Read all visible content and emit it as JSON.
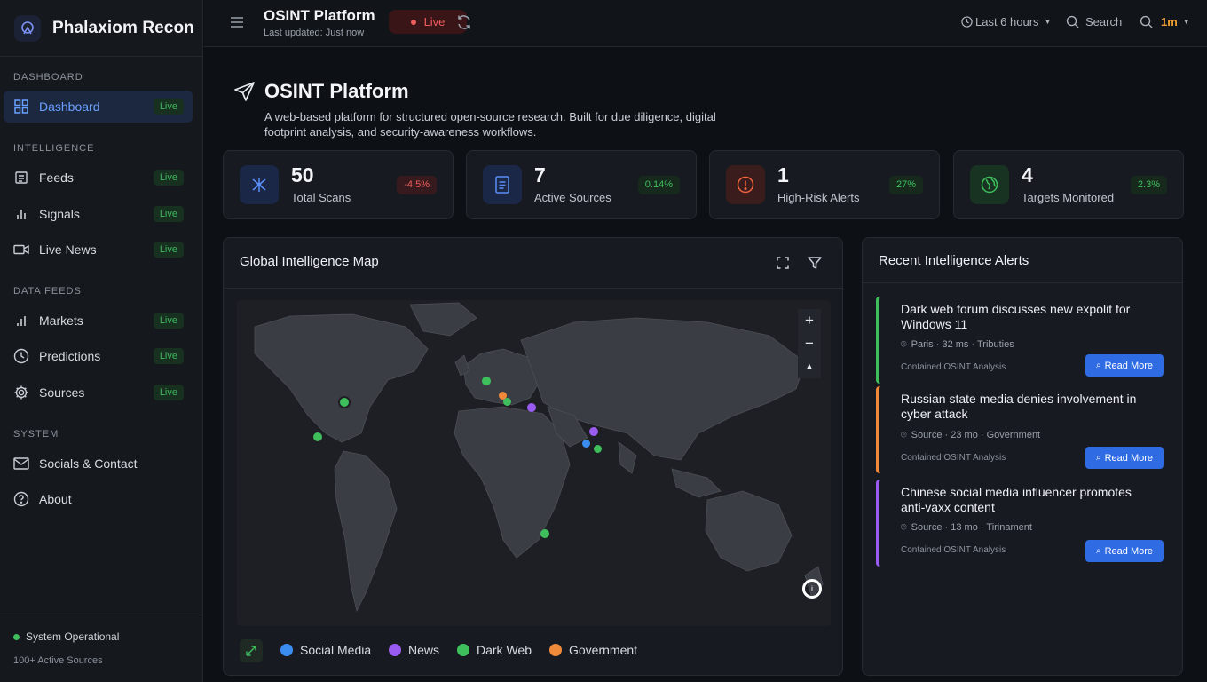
{
  "brand": {
    "name": "Phalaxiom Recon"
  },
  "sidebar": {
    "sections": [
      {
        "title": "DASHBOARD",
        "items": [
          {
            "label": "Dashboard",
            "badge": "Live",
            "icon": "grid-icon"
          }
        ]
      },
      {
        "title": "INTELLIGENCE",
        "items": [
          {
            "label": "Feeds",
            "badge": "Live",
            "icon": "feed-icon"
          },
          {
            "label": "Signals",
            "badge": "Live",
            "icon": "bar-chart-icon"
          },
          {
            "label": "Live News",
            "badge": "Live",
            "icon": "video-icon"
          }
        ]
      },
      {
        "title": "DATA FEEDS",
        "items": [
          {
            "label": "Markets",
            "badge": "Live",
            "icon": "bar-chart-icon"
          },
          {
            "label": "Predictions",
            "badge": "Live",
            "icon": "clock-icon"
          },
          {
            "label": "Sources",
            "badge": "Live",
            "icon": "gear-icon"
          }
        ]
      },
      {
        "title": "SYSTEM",
        "items": [
          {
            "label": "Socials & Contact",
            "icon": "mail-icon"
          },
          {
            "label": "About",
            "icon": "help-icon"
          }
        ]
      }
    ],
    "footer": {
      "status": "System Operational",
      "sources": "100+ Active Sources"
    }
  },
  "header": {
    "title": "OSINT Platform",
    "subtitle": "Last updated: Just now",
    "live_label": "Live",
    "time_range": "Last 6 hours",
    "search_label": "Search",
    "interval": "1m"
  },
  "page": {
    "title": "OSINT Platform",
    "description": "A web-based platform for structured open-source research. Built for due diligence, digital footprint analysis, and security-awareness workflows."
  },
  "stats": [
    {
      "value": "50",
      "label": "Total Scans",
      "change": "-4.5%",
      "color": "#f05d5d",
      "icon": "network-icon"
    },
    {
      "value": "7",
      "label": "Active Sources",
      "change": "0.14%",
      "color": "#3fbf5c",
      "icon": "document-icon"
    },
    {
      "value": "1",
      "label": "High-Risk Alerts",
      "change": "27%",
      "color": "#3fbf5c",
      "icon": "warning-icon"
    },
    {
      "value": "4",
      "label": "Targets Monitored",
      "change": "2.3%",
      "color": "#3fbf5c",
      "icon": "globe-icon"
    }
  ],
  "map": {
    "title": "Global Intelligence Map",
    "zoom_in": "+",
    "zoom_out": "−",
    "legend": [
      {
        "label": "Social Media",
        "color": "#3b8df0"
      },
      {
        "label": "News",
        "color": "#9a5cf0"
      },
      {
        "label": "Dark Web",
        "color": "#3fbf5c"
      },
      {
        "label": "Government",
        "color": "#f08a3b"
      }
    ]
  },
  "alerts_panel": {
    "title": "Recent Intelligence Alerts",
    "alerts": [
      {
        "title": "Dark web forum discusses new expolit for Windows 11",
        "meta": "Paris · 32 ms · Tributies",
        "caption": "Contained OSINT Analysis",
        "button": "Read More",
        "color": "#3fbf5c"
      },
      {
        "title": "Russian state media denies involvement in cyber attack",
        "meta": "Source · 23 mo · Government",
        "caption": "Contained OSINT Analysis",
        "button": "Read More",
        "color": "#f08a3b"
      },
      {
        "title": "Chinese social media influencer promotes anti-vaxx content",
        "meta": "Source · 13 mo · Tirinament",
        "caption": "Contained OSINT Analysis",
        "button": "Read More",
        "color": "#9a5cf0"
      }
    ]
  }
}
